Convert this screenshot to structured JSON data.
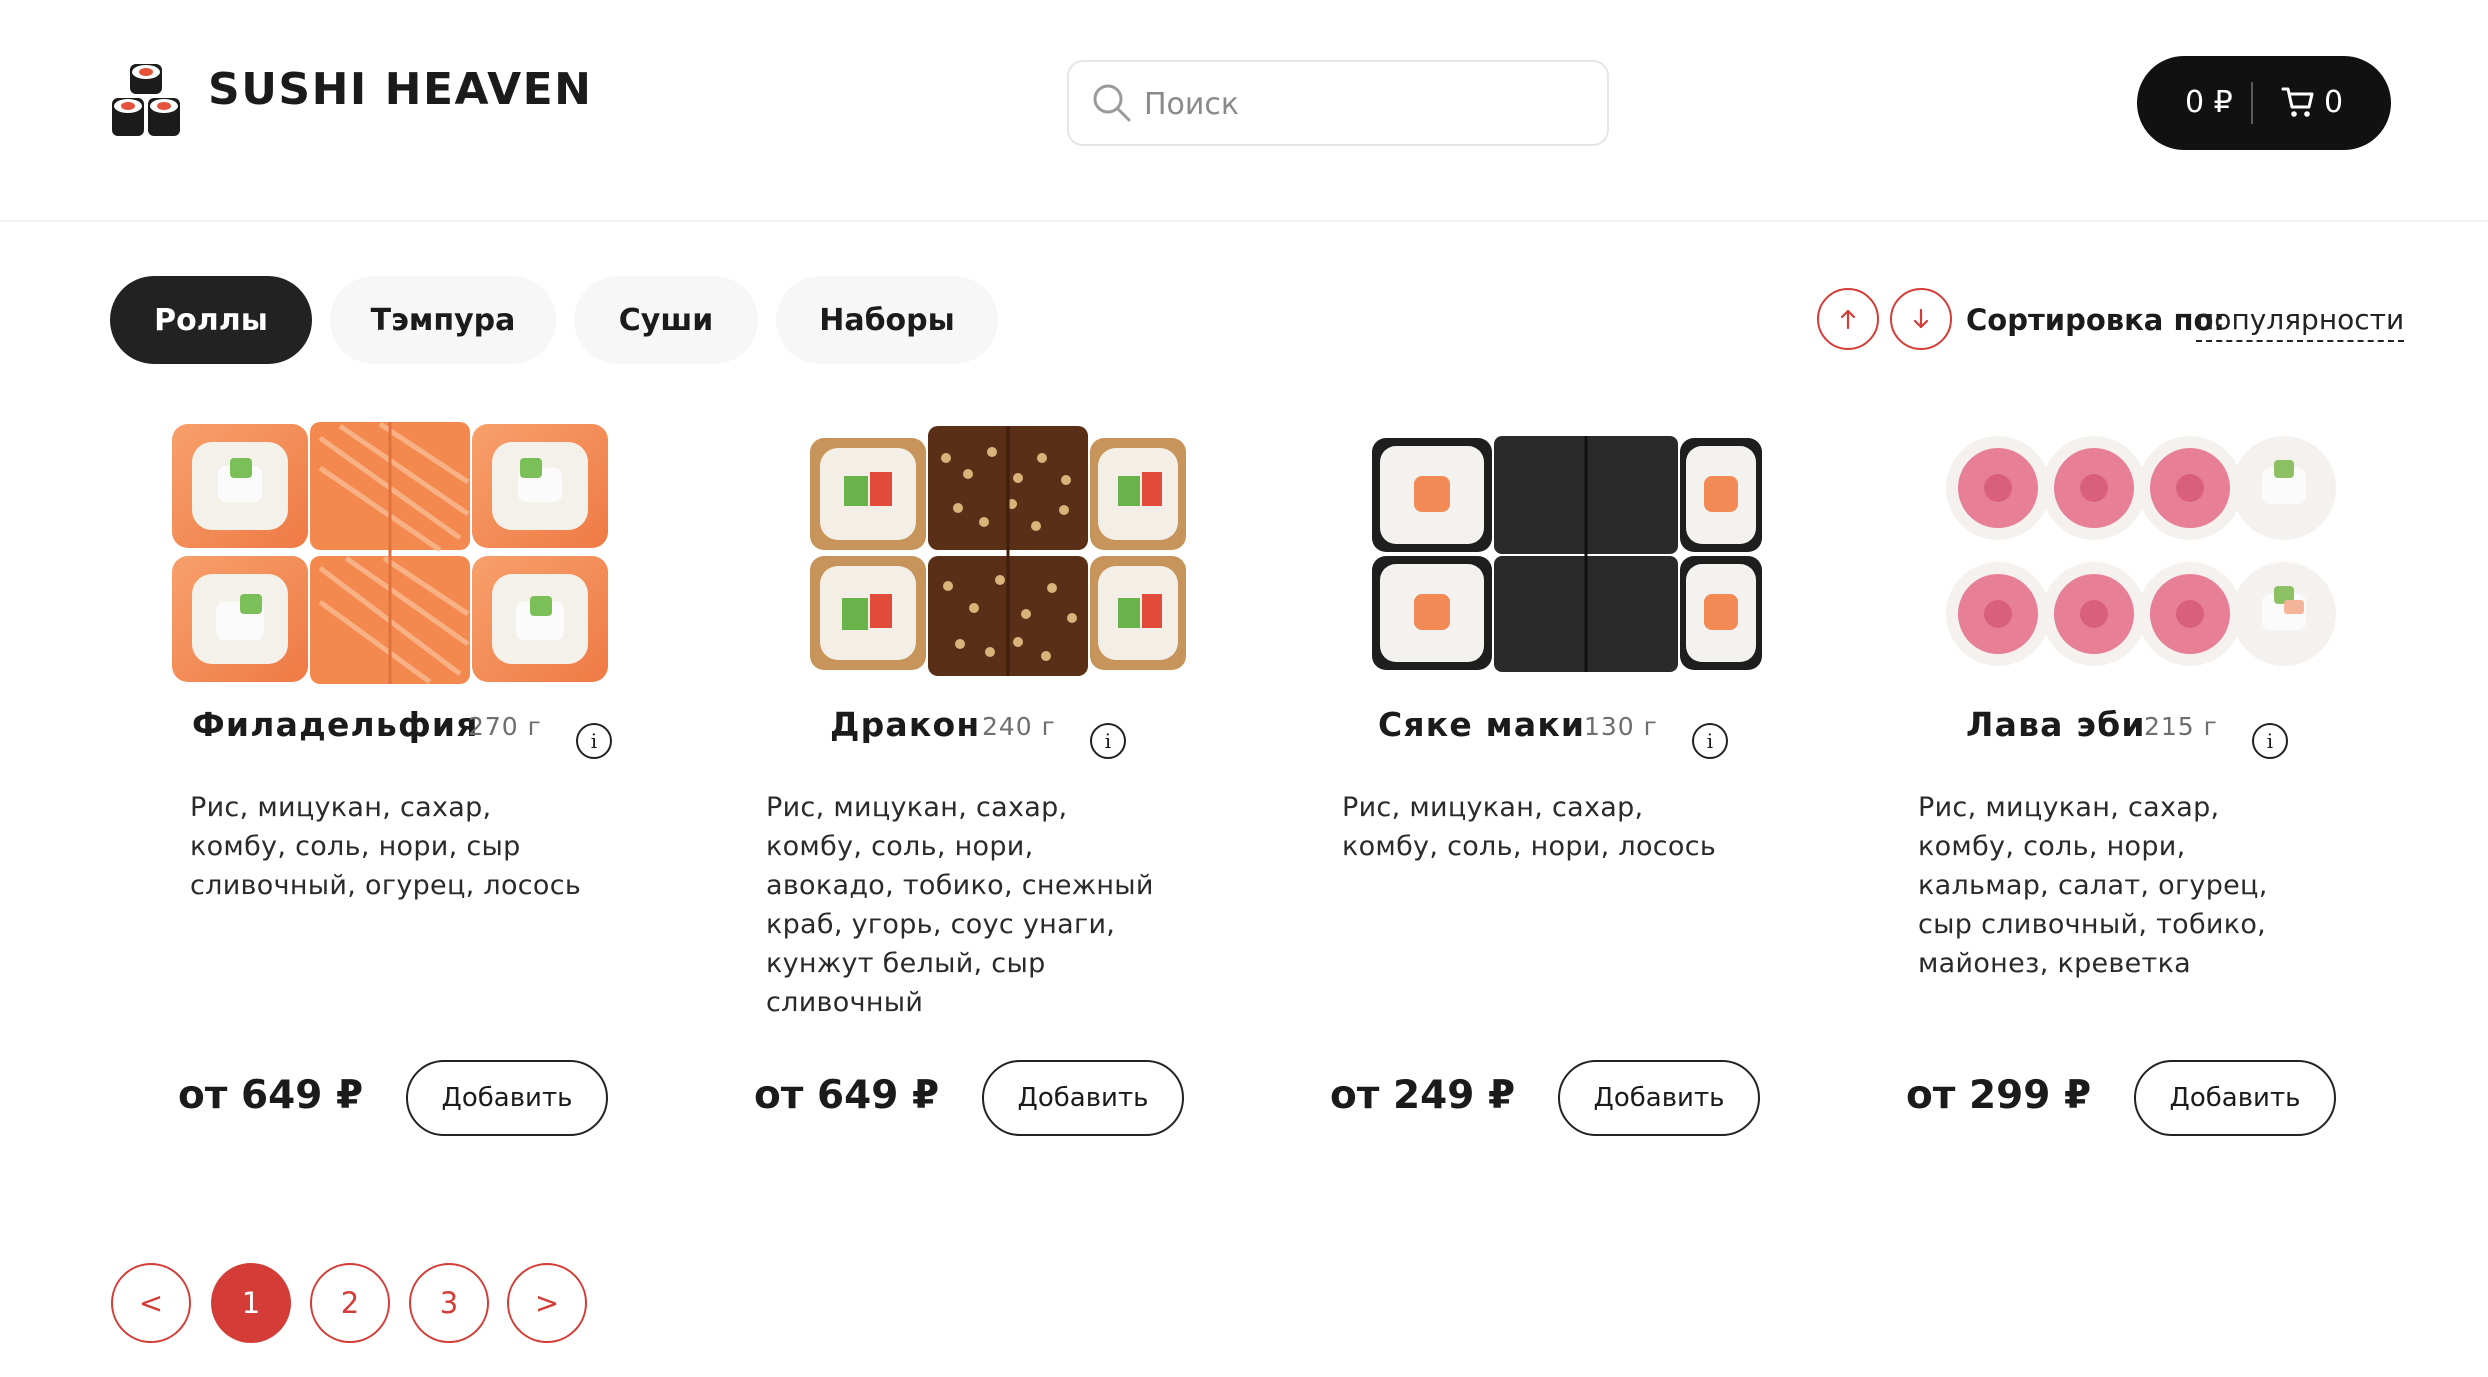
{
  "header": {
    "brand": "SUSHI HEAVEN",
    "search_placeholder": "Поиск",
    "cart_total": "0 ₽",
    "cart_count": "0"
  },
  "categories": [
    {
      "label": "Роллы",
      "active": true
    },
    {
      "label": "Тэмпура",
      "active": false
    },
    {
      "label": "Суши",
      "active": false
    },
    {
      "label": "Наборы",
      "active": false
    }
  ],
  "sort": {
    "label": "Сортировка по:",
    "value": "популярности"
  },
  "products": [
    {
      "name": "Филадельфия",
      "weight": "270 г",
      "description": "Рис, мицукан, сахар, комбу, соль, нори, сыр сливочный, огурец, лосось",
      "price": "от 649 ₽",
      "add_label": "Добавить"
    },
    {
      "name": "Дракон",
      "weight": "240 г",
      "description": "Рис, мицукан, сахар, комбу, соль, нори, авокадо, тобико, снежный краб, угорь, соус унаги, кунжут белый, сыр сливочный",
      "price": "от 649 ₽",
      "add_label": "Добавить"
    },
    {
      "name": "Сяке маки",
      "weight": "130 г",
      "description": "Рис, мицукан, сахар, комбу, соль, нори, лосось",
      "price": "от 249 ₽",
      "add_label": "Добавить"
    },
    {
      "name": "Лава эби",
      "weight": "215 г",
      "description": "Рис, мицукан, сахар, комбу, соль, нори, кальмар, салат, огурец, сыр сливочный, тобико, майонез, креветка",
      "price": "от 299 ₽",
      "add_label": "Добавить"
    }
  ],
  "pagination": {
    "prev": "<",
    "next": ">",
    "pages": [
      "1",
      "2",
      "3"
    ],
    "current": "1"
  },
  "colors": {
    "accent": "#d43d37",
    "dark": "#111111",
    "chip_bg": "#f7f7f7"
  },
  "icons": [
    "sushi-logo-icon",
    "search-icon",
    "cart-icon",
    "arrow-up-icon",
    "arrow-down-icon",
    "info-icon"
  ]
}
